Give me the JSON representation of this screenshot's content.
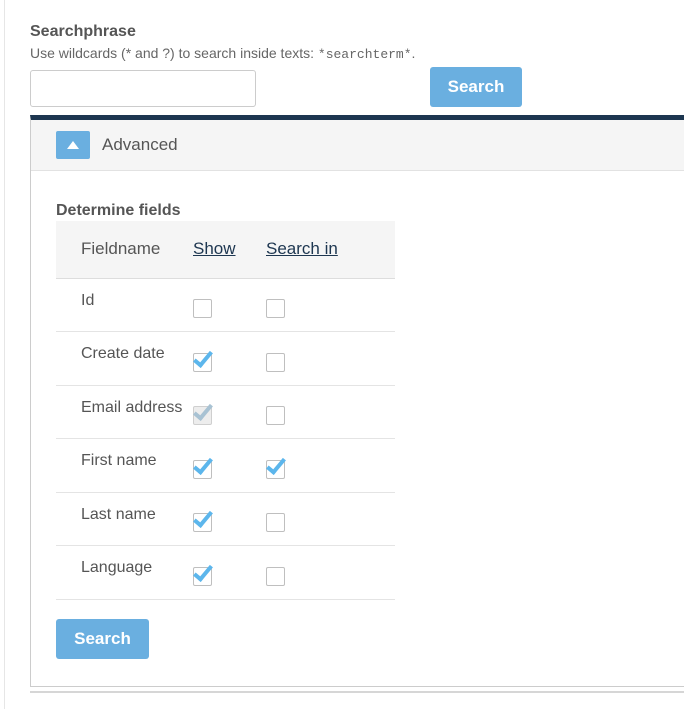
{
  "search": {
    "label": "Searchphrase",
    "hint_prefix": "Use wildcards (* and ?) to search inside texts: ",
    "hint_code": "*searchterm*",
    "hint_suffix": ".",
    "value": "",
    "placeholder": "",
    "button_label": "Search"
  },
  "advanced": {
    "label": "Advanced",
    "expanded": true,
    "fields_title": "Determine fields",
    "columns": {
      "fieldname": "Fieldname",
      "show": "Show",
      "search_in": "Search in"
    },
    "rows": [
      {
        "name": "Id",
        "show": false,
        "show_disabled": false,
        "search_in": false
      },
      {
        "name": "Create date",
        "show": true,
        "show_disabled": false,
        "search_in": false
      },
      {
        "name": "Email address",
        "show": true,
        "show_disabled": true,
        "search_in": false
      },
      {
        "name": "First name",
        "show": true,
        "show_disabled": false,
        "search_in": true
      },
      {
        "name": "Last name",
        "show": true,
        "show_disabled": false,
        "search_in": false
      },
      {
        "name": "Language",
        "show": true,
        "show_disabled": false,
        "search_in": false
      }
    ],
    "button_label": "Search"
  },
  "colors": {
    "accent": "#6aafe0",
    "panel_border": "#1d3650",
    "check": "#5cb6ec"
  },
  "icons": {
    "toggle": "triangle-up-icon",
    "checkbox_mark": "checkmark-icon"
  }
}
